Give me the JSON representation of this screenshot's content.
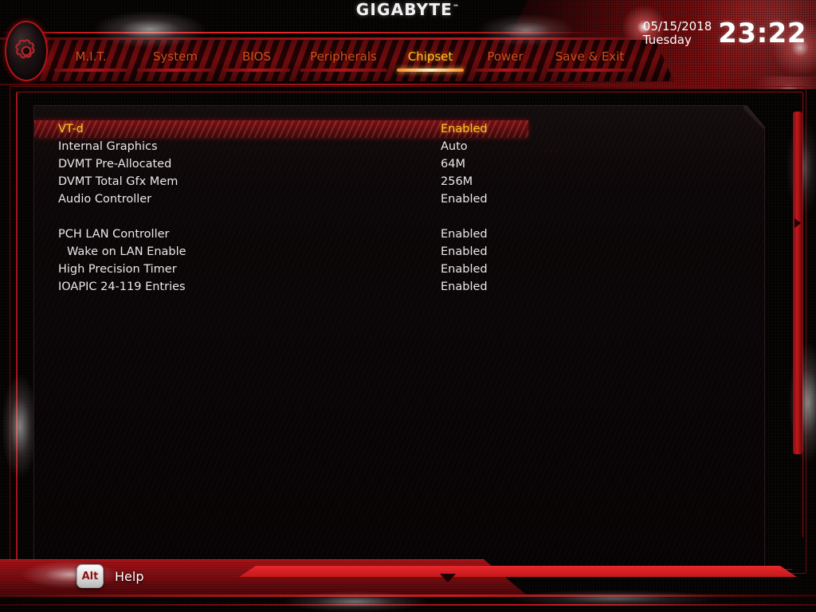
{
  "brand": {
    "name": "GIGABYTE",
    "tm": "™"
  },
  "datetime": {
    "date": "05/15/2018",
    "weekday": "Tuesday",
    "time": "23:22"
  },
  "tabs": [
    {
      "label": "M.I.T.",
      "active": false
    },
    {
      "label": "System",
      "active": false
    },
    {
      "label": "BIOS",
      "active": false
    },
    {
      "label": "Peripherals",
      "active": false
    },
    {
      "label": "Chipset",
      "active": true
    },
    {
      "label": "Power",
      "active": false
    },
    {
      "label": "Save & Exit",
      "active": false
    }
  ],
  "settings": [
    {
      "label": "VT-d",
      "value": "Enabled",
      "selected": true,
      "sub": false
    },
    {
      "label": "Internal Graphics",
      "value": "Auto",
      "selected": false,
      "sub": false
    },
    {
      "label": "DVMT Pre-Allocated",
      "value": "64M",
      "selected": false,
      "sub": false
    },
    {
      "label": "DVMT Total Gfx Mem",
      "value": "256M",
      "selected": false,
      "sub": false
    },
    {
      "label": "Audio Controller",
      "value": "Enabled",
      "selected": false,
      "sub": false
    },
    {
      "label": "",
      "value": "",
      "selected": false,
      "sub": false,
      "spacer": true
    },
    {
      "label": "PCH LAN Controller",
      "value": "Enabled",
      "selected": false,
      "sub": false
    },
    {
      "label": "Wake on LAN Enable",
      "value": "Enabled",
      "selected": false,
      "sub": true
    },
    {
      "label": "High Precision Timer",
      "value": "Enabled",
      "selected": false,
      "sub": false
    },
    {
      "label": "IOAPIC 24-119 Entries",
      "value": "Enabled",
      "selected": false,
      "sub": false
    }
  ],
  "ghost_dots": "...",
  "footer": {
    "alt_key": "Alt",
    "help_label": "Help"
  },
  "colors": {
    "accent_red": "#c4181c",
    "tab_inactive": "#d2511c",
    "tab_active": "#ffc223",
    "selected_text": "#ffc223",
    "value_text": "#e9e9e9",
    "background": "#050202"
  }
}
